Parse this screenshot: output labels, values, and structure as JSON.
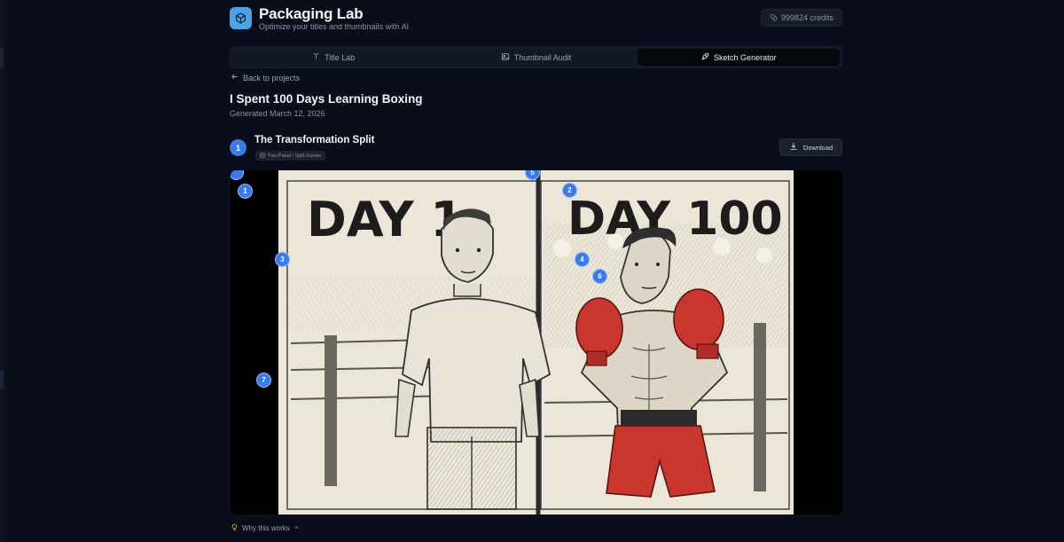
{
  "app": {
    "title": "Packaging Lab",
    "subtitle": "Optimize your titles and thumbnails with AI",
    "logo_icon": "box-icon",
    "credits": "999824 credits"
  },
  "tabs": [
    {
      "label": "Title Lab",
      "icon": "text-icon",
      "active": false
    },
    {
      "label": "Thumbnail Audit",
      "icon": "image-icon",
      "active": false
    },
    {
      "label": "Sketch Generator",
      "icon": "rocket-icon",
      "active": true
    }
  ],
  "nav": {
    "back_label": "Back to projects"
  },
  "project": {
    "title": "I Spent 100 Days Learning Boxing",
    "generated": "Generated March 12, 2026"
  },
  "concept": {
    "number": "1",
    "title": "The Transformation Split",
    "badge": "Two-Panel / Split Screen",
    "download_label": "Download"
  },
  "sketch": {
    "left_heading": "DAY 1",
    "right_heading": "DAY 100",
    "markers": [
      "1",
      "2",
      "3",
      "4",
      "5",
      "6",
      "7"
    ]
  },
  "footer": {
    "why_label": "Why this works"
  },
  "colors": {
    "background": "#0a0e1a",
    "accent": "#3b7be8",
    "logo": "#4aa3e8",
    "glove_red": "#c8362e"
  }
}
